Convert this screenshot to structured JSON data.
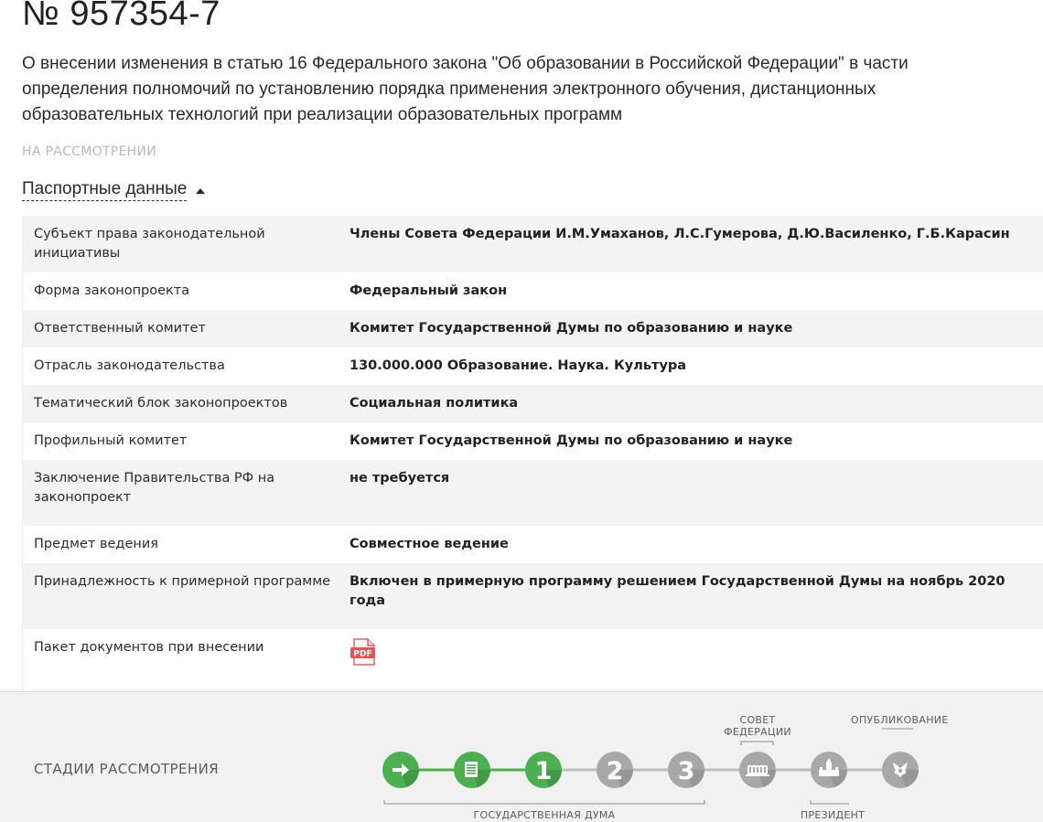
{
  "bill": {
    "number": "№ 957354-7",
    "title": "О внесении изменения в статью 16 Федерального закона \"Об образовании в Российской Федерации\" в части определения полномочий по установлению порядка применения электронного обучения, дистанционных образовательных технологий при реализации образовательных программ",
    "status": "НА РАССМОТРЕНИИ"
  },
  "passport": {
    "toggle_label": "Паспортные данные",
    "rows": [
      {
        "key": "Субъект права законодательной инициативы",
        "value": "Члены Совета Федерации И.М.Умаханов, Л.С.Гумерова, Д.Ю.Василенко, Г.Б.Карасин"
      },
      {
        "key": "Форма законопроекта",
        "value": "Федеральный закон"
      },
      {
        "key": "Ответственный комитет",
        "value": "Комитет Государственной Думы по образованию и науке"
      },
      {
        "key": "Отрасль законодательства",
        "value": "130.000.000 Образование. Наука. Культура"
      },
      {
        "key": "Тематический блок законопроектов",
        "value": "Социальная политика"
      },
      {
        "key": "Профильный комитет",
        "value": "Комитет Государственной Думы по образованию и науке"
      },
      {
        "key": "Заключение Правительства РФ на законопроект",
        "value": "не требуется"
      },
      {
        "key": "Предмет ведения",
        "value": "Совместное ведение"
      },
      {
        "key": "Принадлежность к примерной программе",
        "value": "Включен в примерную программу решением Государственной Думы на ноябрь 2020 года"
      },
      {
        "key": "Пакет документов при внесении",
        "value": ""
      }
    ],
    "pdf_icon_text": "PDF"
  },
  "stages": {
    "label": "СТАДИИ РАССМОТРЕНИЯ",
    "captions": {
      "federation_council": "СОВЕТ ФЕДЕРАЦИИ",
      "publication": "ОПУБЛИКОВАНИЕ",
      "state_duma": "ГОСУДАРСТВЕННАЯ ДУМА",
      "president": "ПРЕЗИДЕНТ"
    },
    "items": [
      {
        "name": "stage-introduction",
        "icon": "arrow-right-icon",
        "state": "done"
      },
      {
        "name": "stage-preliminary",
        "icon": "document-check-icon",
        "state": "done"
      },
      {
        "name": "stage-first-reading",
        "text": "1",
        "state": "done"
      },
      {
        "name": "stage-second-reading",
        "text": "2",
        "state": "pending"
      },
      {
        "name": "stage-third-reading",
        "text": "3",
        "state": "pending"
      },
      {
        "name": "stage-federation-council",
        "icon": "parliament-building-icon",
        "state": "pending"
      },
      {
        "name": "stage-president",
        "icon": "kremlin-icon",
        "state": "pending"
      },
      {
        "name": "stage-publication",
        "icon": "coat-of-arms-icon",
        "state": "pending"
      }
    ],
    "colors": {
      "done": "#4caf50",
      "pending": "#a8a8a8",
      "line_done": "#4caf50",
      "line_pending": "#bdbdbd"
    }
  }
}
